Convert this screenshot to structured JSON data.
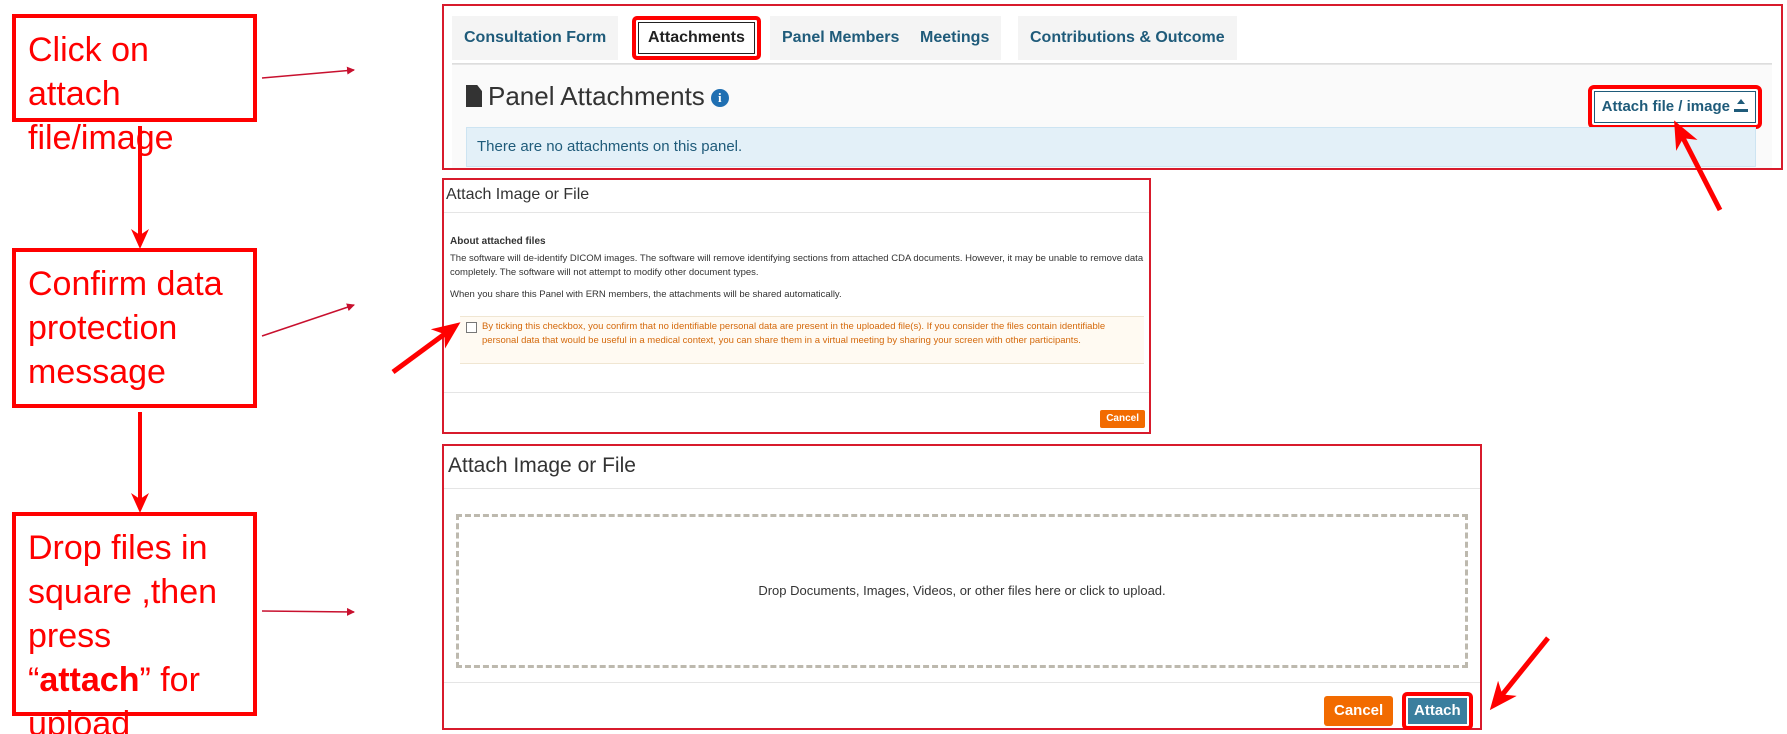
{
  "steps": {
    "step1": "Click on attach file/image",
    "step2": "Confirm data protection message",
    "step3_pre": "Drop files in square ,then press “",
    "step3_bold": "attach",
    "step3_post": "” for upload"
  },
  "tabs": [
    {
      "label": "Consultation Form"
    },
    {
      "label": "Attachments"
    },
    {
      "label": "Panel Members"
    },
    {
      "label": "Meetings"
    },
    {
      "label": "Contributions & Outcome"
    }
  ],
  "panel": {
    "title": "Panel Attachments",
    "info_icon": "i",
    "attach_button": "Attach file / image",
    "empty_message": "There are no attachments on this panel."
  },
  "confirm_modal": {
    "title": "Attach Image or File",
    "about_heading": "About attached files",
    "about_text": "The software will de-identify DICOM images. The software will remove identifying sections from attached CDA documents. However, it may be unable to remove data completely. The software will not attempt to modify other document types.",
    "share_text": "When you share this Panel with ERN members, the attachments will be shared automatically.",
    "consent_text": "By ticking this checkbox, you confirm that no identifiable personal data are present in the uploaded file(s). If you consider the files contain identifiable personal data that would be useful in a medical context, you can share them in a virtual meeting by sharing your screen with other participants.",
    "cancel": "Cancel"
  },
  "upload_modal": {
    "title": "Attach Image or File",
    "dropzone_text": "Drop Documents, Images, Videos, or other files here or click to upload.",
    "cancel": "Cancel",
    "attach": "Attach"
  },
  "colors": {
    "annotation_red": "#ff0000",
    "tab_text": "#1f5b7a",
    "cancel_orange": "#f26b00",
    "attach_blue": "#3b7f9e",
    "info_bg": "#e3f0f8"
  }
}
